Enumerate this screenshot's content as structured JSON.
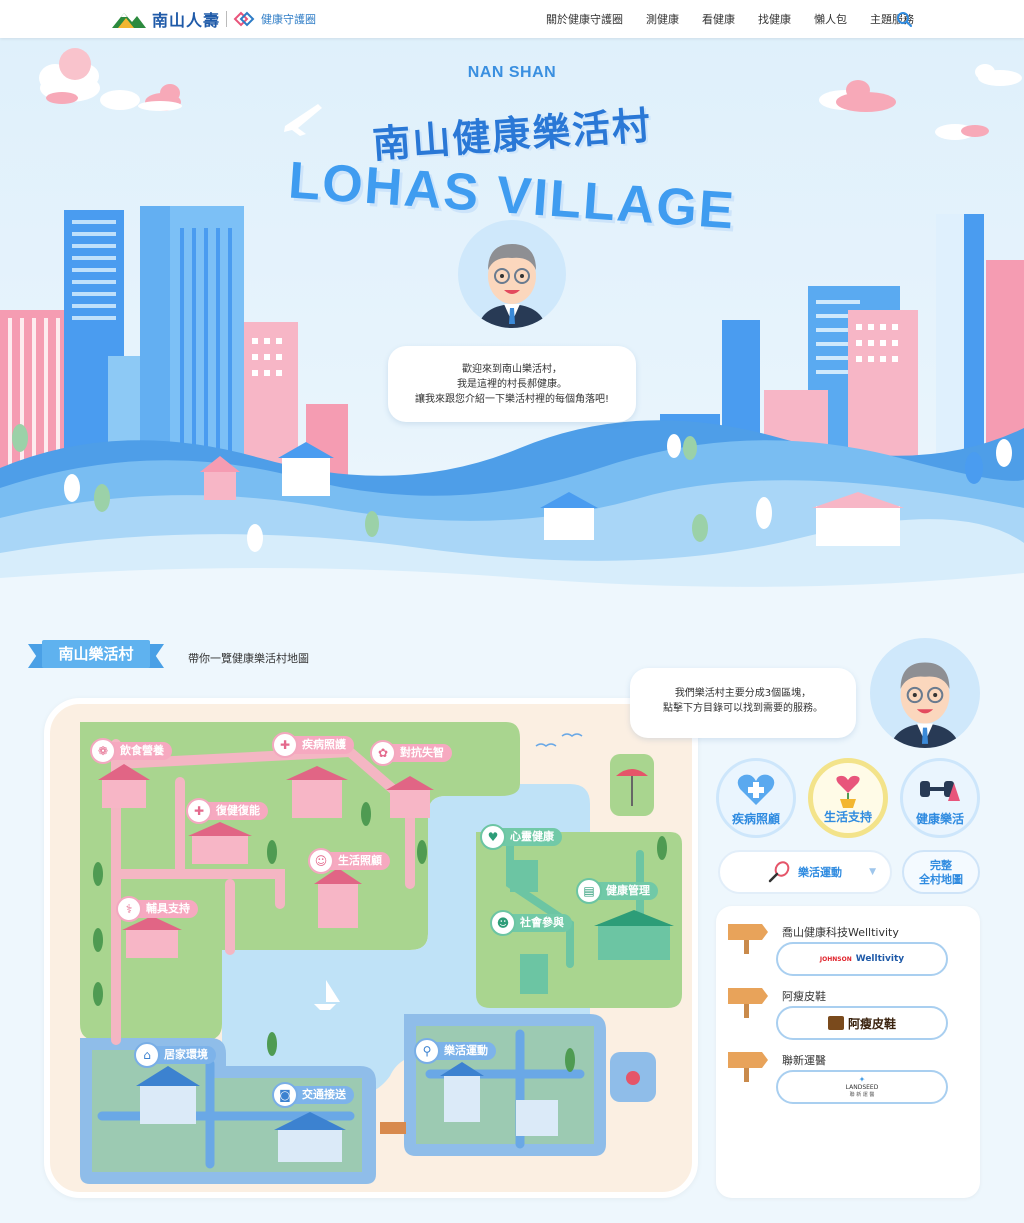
{
  "nav": {
    "logo_name": "南山人壽",
    "logo_sub": "健康守護圈",
    "menu": [
      "關於健康守護圈",
      "測健康",
      "看健康",
      "找健康",
      "懶人包",
      "主題服務"
    ]
  },
  "hero": {
    "subtitle": "NAN SHAN",
    "title": "南山健康樂活村",
    "title_en": "LOHAS VILLAGE",
    "bubble": [
      "歡迎來到南山樂活村，",
      "我是這裡的村長郝健康。",
      "讓我來跟您介紹一下樂活村裡的每個角落吧!"
    ]
  },
  "section": {
    "tag": "南山樂活村",
    "desc": "帶你一覽健康樂活村地圖"
  },
  "map": {
    "pink_pins": [
      "飲食營養",
      "疾病照護",
      "對抗失智",
      "復健復能",
      "生活照顧",
      "輔具支持"
    ],
    "green_pins": [
      "心靈健康",
      "健康管理",
      "社會參與"
    ],
    "blue_pins": [
      "居家環境",
      "交通接送",
      "樂活運動"
    ]
  },
  "panel": {
    "bubble": [
      "我們樂活村主要分成3個區塊，",
      "點擊下方目錄可以找到需要的服務。"
    ],
    "categories": [
      "疾病照顧",
      "生活支持",
      "健康樂活"
    ],
    "dropdown_value": "樂活運動",
    "full_map": [
      "完整",
      "全村地圖"
    ],
    "partners": [
      {
        "name": "喬山健康科技Welltivity",
        "logo": "Welltivity",
        "logo_prefix": "JOHNSON"
      },
      {
        "name": "阿瘦皮鞋",
        "logo": "阿瘦皮鞋",
        "logo_prefix": ""
      },
      {
        "name": "聯新運醫",
        "logo": "LANDSEED",
        "logo_prefix": "聯 新 運 醫"
      }
    ]
  },
  "colors": {
    "accent": "#2f8be0",
    "pink": "#f6a9c0",
    "green": "#71c9a7",
    "blue": "#7db3ea"
  }
}
